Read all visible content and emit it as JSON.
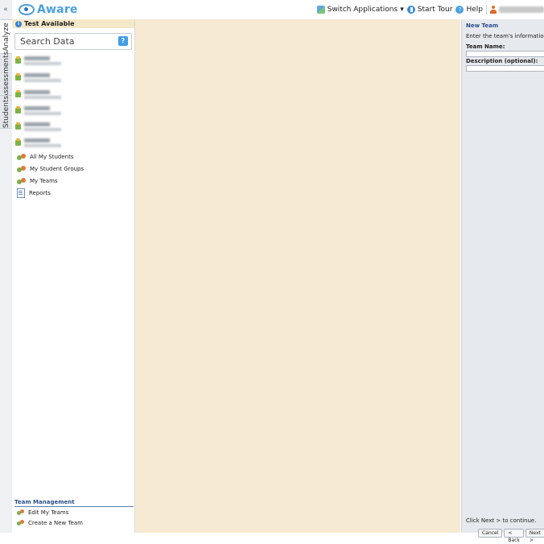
{
  "app": {
    "name": "Aware"
  },
  "toolbar": {
    "switch_apps": "Switch Applications",
    "switch_apps_caret": "▾",
    "start_tour": "Start Tour",
    "help": "Help"
  },
  "side_tabs": {
    "collapse": "«",
    "analyze": "Analyze",
    "assessments": "Assessments",
    "students": "Students"
  },
  "left": {
    "test_available": "Test Available",
    "search_placeholder": "Search Data",
    "search_help": "?",
    "nav": {
      "all_students": "All My Students",
      "student_groups": "My Student Groups",
      "teams": "My Teams",
      "reports": "Reports"
    },
    "team_mgmt": {
      "header": "Team Management",
      "edit": "Edit My Teams",
      "create": "Create a New Team"
    }
  },
  "right": {
    "title": "New Team",
    "desc": "Enter the team's information below.",
    "team_name_label": "Team Name:",
    "desc_label": "Description (optional):",
    "continue": "Click Next > to continue.",
    "buttons": {
      "cancel": "Cancel",
      "back": "< Back",
      "next": "Next >"
    }
  },
  "colors": {
    "accent": "#4aa0e0",
    "center_bg": "#f7ead2",
    "panel_bg": "#e6e9ed",
    "header_blue": "#2b4e8c"
  }
}
